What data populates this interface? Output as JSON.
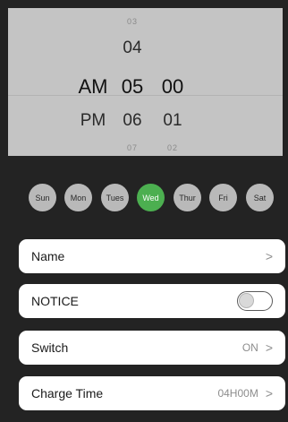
{
  "time_picker": {
    "hour_above": "03",
    "hour_prev": "04",
    "hour_selected": "05",
    "hour_next": "06",
    "hour_below": "07",
    "ampm_selected": "AM",
    "ampm_next": "PM",
    "minute_selected": "00",
    "minute_next": "01",
    "minute_below": "02"
  },
  "days": [
    {
      "label": "Sun",
      "active": false
    },
    {
      "label": "Mon",
      "active": false
    },
    {
      "label": "Tues",
      "active": false
    },
    {
      "label": "Wed",
      "active": true
    },
    {
      "label": "Thur",
      "active": false
    },
    {
      "label": "Fri",
      "active": false
    },
    {
      "label": "Sat",
      "active": false
    }
  ],
  "settings": {
    "name": {
      "label": "Name",
      "chevron": ">"
    },
    "notice": {
      "label": "NOTICE",
      "enabled": false
    },
    "switch": {
      "label": "Switch",
      "value": "ON",
      "chevron": ">"
    },
    "charge_time": {
      "label": "Charge Time",
      "value": "04H00M",
      "chevron": ">"
    }
  },
  "colors": {
    "background": "#232323",
    "picker_background": "#c4c4c4",
    "day_inactive": "#b9b9b9",
    "day_active": "#4caf50"
  }
}
